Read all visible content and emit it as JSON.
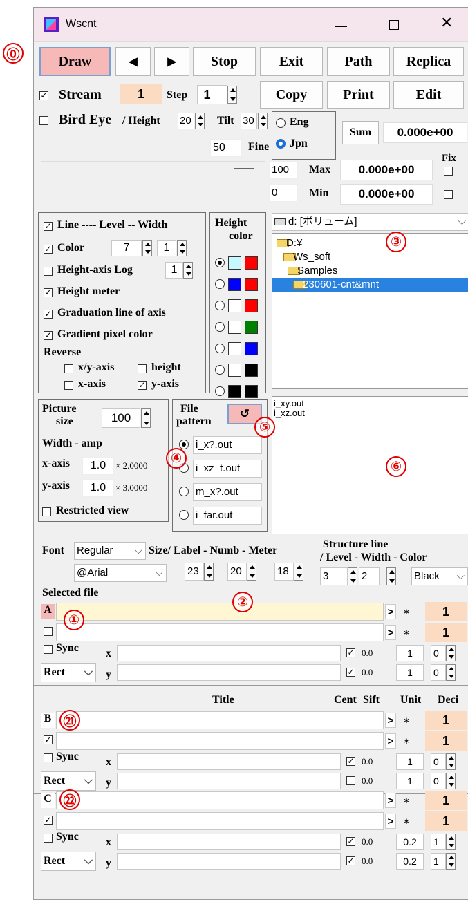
{
  "window": {
    "title": "Wscnt"
  },
  "annotations": {
    "a0": "⓪",
    "a1": "①",
    "a2": "②",
    "a3": "③",
    "a4": "④",
    "a5": "⑤",
    "a6": "⑥",
    "a21": "㉑",
    "a22": "㉒"
  },
  "toolbar": {
    "draw": "Draw",
    "prev": "◀",
    "next": "▶",
    "stop": "Stop",
    "exit": "Exit",
    "path": "Path",
    "replica": "Replica",
    "copy": "Copy",
    "print": "Print",
    "edit": "Edit",
    "sum": "Sum"
  },
  "stream": {
    "label": "Stream",
    "value": "1",
    "step_label": "Step",
    "step_value": "1"
  },
  "birdeye": {
    "label": "Bird Eye",
    "height_label": "/ Height",
    "height_value": "20",
    "tilt_label": "Tilt",
    "tilt_value": "30"
  },
  "lang": {
    "eng": "Eng",
    "jpn": "Jpn"
  },
  "fine": {
    "value": "50",
    "label": "Fine"
  },
  "sum_value": "0.000e+00",
  "fix_label": "Fix",
  "max": {
    "slider": "100",
    "label": "Max",
    "value": "0.000e+00"
  },
  "min": {
    "slider": "0",
    "label": "Min",
    "value": "0.000e+00"
  },
  "options": {
    "line": "Line ---- Level -- Width",
    "color": "Color",
    "color_level": "7",
    "color_width": "1",
    "log": "Height-axis Log",
    "log_value": "1",
    "meter": "Height meter",
    "grad_line": "Graduation line of axis",
    "grad_pixel": "Gradient pixel color",
    "reverse": "Reverse",
    "xy_axis": "x/y-axis",
    "height": "height",
    "x_axis": "x-axis",
    "y_axis": "y-axis"
  },
  "height_color": {
    "title1": "Height",
    "title2": "color"
  },
  "drive": {
    "value": "d: [ボリューム]"
  },
  "folders": [
    "D:¥",
    "Ws_soft",
    "Samples",
    "230601-cnt&mnt"
  ],
  "picture": {
    "label1": "Picture",
    "label2": "size",
    "size": "100",
    "width_amp": "Width - amp",
    "x_label": "x-axis",
    "x_value": "1.0",
    "x_mult": "× 2.0000",
    "y_label": "y-axis",
    "y_value": "1.0",
    "y_mult": "× 3.0000",
    "restricted": "Restricted view"
  },
  "pattern": {
    "label1": "File",
    "label2": "pattern",
    "refresh": "↺",
    "items": [
      "i_x?.out",
      "i_xz_t.out",
      "m_x?.out",
      "i_far.out"
    ]
  },
  "files": [
    "i_xy.out",
    "i_xz.out"
  ],
  "font": {
    "label": "Font",
    "style": "Regular",
    "name": "@Arial",
    "size_label": "Size/ Label - Numb - Meter",
    "label_size": "23",
    "numb_size": "20",
    "meter_size": "18"
  },
  "structure": {
    "title1": "Structure line",
    "title2": "/ Level - Width - Color",
    "level": "3",
    "width": "2",
    "color": "Black"
  },
  "selected_file": "Selected file",
  "headers": {
    "title": "Title",
    "cent": "Cent",
    "sift": "Sift",
    "unit": "Unit",
    "deci": "Deci"
  },
  "sel_common": {
    "gt": ">",
    "star": "∗",
    "one": "1",
    "sync": "Sync",
    "rect": "Rect",
    "x": "x",
    "y": "y"
  },
  "blocks": [
    {
      "letter": "A",
      "x_cent": "0.0",
      "x_unit": "1",
      "x_deci": "0",
      "y_cent": "0.0",
      "y_unit": "1",
      "y_deci": "0"
    },
    {
      "letter": "B",
      "x_cent": "0.0",
      "x_unit": "1",
      "x_deci": "0",
      "y_cent": "0.0",
      "y_unit": "1",
      "y_deci": "0"
    },
    {
      "letter": "C",
      "x_cent": "0.0",
      "x_unit": "0.2",
      "x_deci": "1",
      "y_cent": "0.0",
      "y_unit": "0.2",
      "y_deci": "1"
    }
  ]
}
